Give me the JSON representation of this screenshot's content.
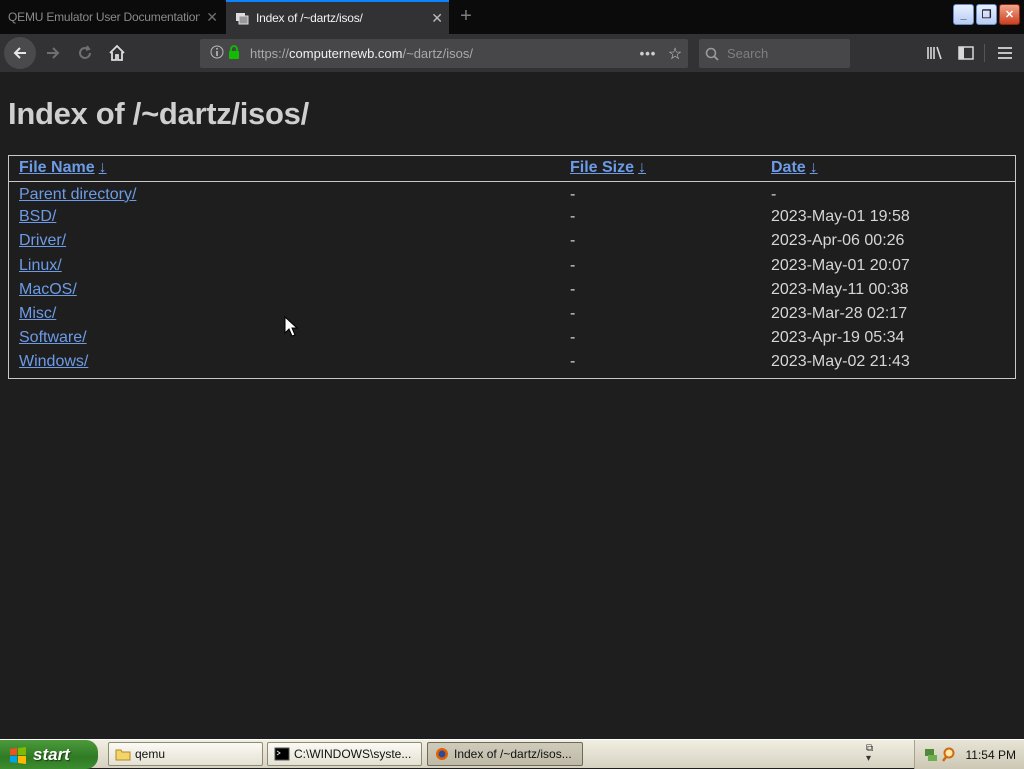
{
  "browser": {
    "tabs": [
      {
        "title": "QEMU Emulator User Documentation",
        "active": false
      },
      {
        "title": "Index of /~dartz/isos/",
        "active": true
      }
    ],
    "url": {
      "prefix": "https://",
      "host": "computernewb.com",
      "path": "/~dartz/isos/"
    },
    "search_placeholder": "Search",
    "page_actions_label": "•••"
  },
  "page": {
    "title": "Index of /~dartz/isos/",
    "columns": [
      {
        "label": "File Name",
        "arrow": "↓"
      },
      {
        "label": "File Size",
        "arrow": "↓"
      },
      {
        "label": "Date",
        "arrow": "↓"
      }
    ],
    "rows": [
      {
        "name": "Parent directory/",
        "size": "-",
        "date": "-"
      },
      {
        "name": "BSD/",
        "size": "-",
        "date": "2023-May-01 19:58"
      },
      {
        "name": "Driver/",
        "size": "-",
        "date": "2023-Apr-06 00:26"
      },
      {
        "name": "Linux/",
        "size": "-",
        "date": "2023-May-01 20:07"
      },
      {
        "name": "MacOS/",
        "size": "-",
        "date": "2023-May-11 00:38"
      },
      {
        "name": "Misc/",
        "size": "-",
        "date": "2023-Mar-28 02:17"
      },
      {
        "name": "Software/",
        "size": "-",
        "date": "2023-Apr-19 05:34"
      },
      {
        "name": "Windows/",
        "size": "-",
        "date": "2023-May-02 21:43"
      }
    ]
  },
  "taskbar": {
    "start_label": "start",
    "tasks": [
      {
        "label": "qemu",
        "icon": "folder-icon",
        "active": false
      },
      {
        "label": "C:\\WINDOWS\\syste...",
        "icon": "console-icon",
        "active": false
      },
      {
        "label": "Index of /~dartz/isos...",
        "icon": "firefox-icon",
        "active": true
      }
    ],
    "clock": "11:54 PM"
  },
  "colors": {
    "page_bg": "#1e1e1f",
    "link": "#6d9be6",
    "toolbar": "#323234",
    "accent": "#0a84ff"
  }
}
